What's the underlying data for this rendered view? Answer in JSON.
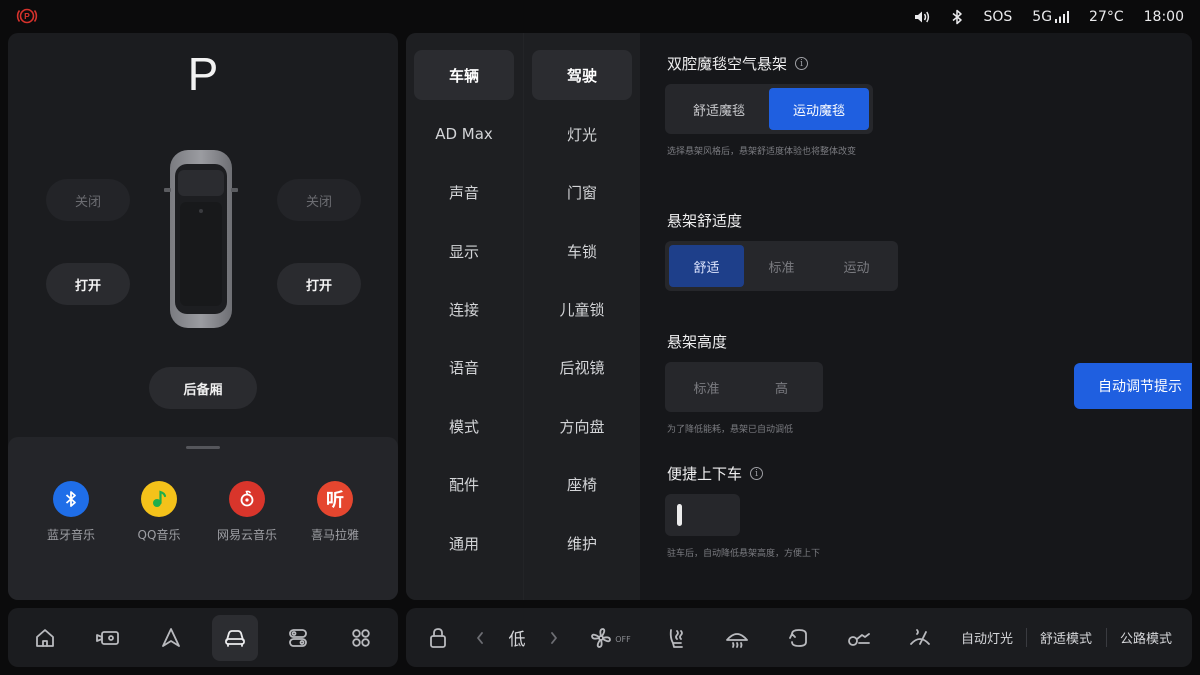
{
  "status": {
    "sos": "SOS",
    "network": "5G",
    "temperature": "27°C",
    "time": "18:00"
  },
  "left": {
    "gear": "P",
    "front_left": "关闭",
    "front_right": "关闭",
    "rear_left": "打开",
    "rear_right": "打开",
    "trunk": "后备厢",
    "apps": [
      {
        "label": "蓝牙音乐",
        "color": "#1f6ee8",
        "icon": "bluetooth-icon"
      },
      {
        "label": "QQ音乐",
        "color": "#f4c21a",
        "icon": "qq-music-icon"
      },
      {
        "label": "网易云音乐",
        "color": "#d9352b",
        "icon": "netease-music-icon"
      },
      {
        "label": "喜马拉雅",
        "color": "#e5462f",
        "icon_text": "听",
        "icon": "ximalaya-icon"
      }
    ]
  },
  "nav": {
    "col1": [
      "车辆",
      "AD Max",
      "声音",
      "显示",
      "连接",
      "语音",
      "模式",
      "配件",
      "通用"
    ],
    "col2": [
      "驾驶",
      "灯光",
      "门窗",
      "车锁",
      "儿童锁",
      "后视镜",
      "方向盘",
      "座椅",
      "维护"
    ]
  },
  "content": {
    "suspension": {
      "title": "双腔魔毯空气悬架",
      "options": [
        "舒适魔毯",
        "运动魔毯"
      ],
      "hint": "选择悬架风格后，悬架舒适度体验也将整体改变"
    },
    "comfort": {
      "title": "悬架舒适度",
      "options": [
        "舒适",
        "标准",
        "运动"
      ]
    },
    "height": {
      "title": "悬架高度",
      "options": [
        "标准",
        "高"
      ],
      "auto_button": "自动调节提示",
      "hint": "为了降低能耗，悬架已自动调低"
    },
    "easy_entry": {
      "title": "便捷上下车",
      "hint": "驻车后，自动降低悬架高度，方便上下"
    }
  },
  "bottom": {
    "fan_level": "低",
    "fan_off": "OFF",
    "auto_light": "自动灯光",
    "comfort_mode": "舒适模式",
    "road_mode": "公路模式"
  },
  "colors": {
    "accent_blue": "#1f5fe0",
    "selected_navy": "#1e3f8a",
    "parking_red": "#d6322c",
    "suspension_green": "#2fd34e"
  }
}
